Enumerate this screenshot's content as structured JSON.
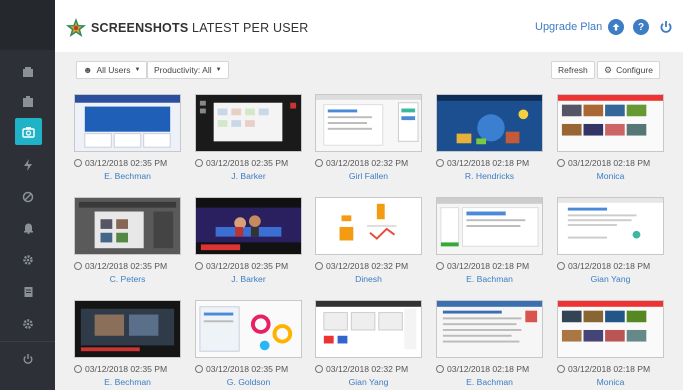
{
  "header": {
    "title_bold": "SCREENSHOTS",
    "title_rest": "LATEST PER USER",
    "upgrade_label": "Upgrade Plan",
    "icons": [
      "arrow-up-circle-icon",
      "help-icon",
      "power-icon"
    ]
  },
  "sidebar": {
    "items": [
      {
        "icon": "dashboard-icon"
      },
      {
        "icon": "reports-icon"
      },
      {
        "icon": "camera-icon",
        "active": true
      },
      {
        "icon": "lightning-icon"
      },
      {
        "icon": "block-icon"
      },
      {
        "icon": "bell-icon"
      },
      {
        "icon": "settings-icon"
      },
      {
        "icon": "document-icon"
      },
      {
        "icon": "gear-icon"
      },
      {
        "icon": "power-icon"
      }
    ]
  },
  "toolbar": {
    "users_filter": "All Users",
    "productivity_filter": "Productivity: All",
    "refresh_label": "Refresh",
    "configure_label": "Configure"
  },
  "colors": {
    "accent": "#20b2c7",
    "link": "#3c7dc4",
    "sidebar": "#2d3137"
  },
  "cards": [
    {
      "time": "03/12/2018 02:35 PM",
      "user": "E. Bechman",
      "thumb": "blue-web"
    },
    {
      "time": "03/12/2018 02:35 PM",
      "user": "J. Barker",
      "thumb": "dark-desktop"
    },
    {
      "time": "03/12/2018 02:32 PM",
      "user": "Girl Fallen",
      "thumb": "light-web"
    },
    {
      "time": "03/12/2018 02:18 PM",
      "user": "R. Hendricks",
      "thumb": "blue-illustration"
    },
    {
      "time": "03/12/2018 02:18 PM",
      "user": "Monica",
      "thumb": "video-grid"
    },
    {
      "time": "03/12/2018 02:35 PM",
      "user": "C. Peters",
      "thumb": "dark-app"
    },
    {
      "time": "03/12/2018 02:35 PM",
      "user": "J. Barker",
      "thumb": "wrestling"
    },
    {
      "time": "03/12/2018 02:32 PM",
      "user": "Dinesh",
      "thumb": "letters"
    },
    {
      "time": "03/12/2018 02:18 PM",
      "user": "E. Bachman",
      "thumb": "green-web"
    },
    {
      "time": "03/12/2018 02:18 PM",
      "user": "Gian Yang",
      "thumb": "white-doc"
    },
    {
      "time": "03/12/2018 02:35 PM",
      "user": "E. Bechman",
      "thumb": "video-player"
    },
    {
      "time": "03/12/2018 02:35 PM",
      "user": "G. Goldson",
      "thumb": "colorful"
    },
    {
      "time": "03/12/2018 02:32 PM",
      "user": "Gian Yang",
      "thumb": "grid-web"
    },
    {
      "time": "03/12/2018 02:18 PM",
      "user": "E. Bachman",
      "thumb": "list-web"
    },
    {
      "time": "03/12/2018 02:18 PM",
      "user": "Monica",
      "thumb": "video-grid-2"
    }
  ]
}
